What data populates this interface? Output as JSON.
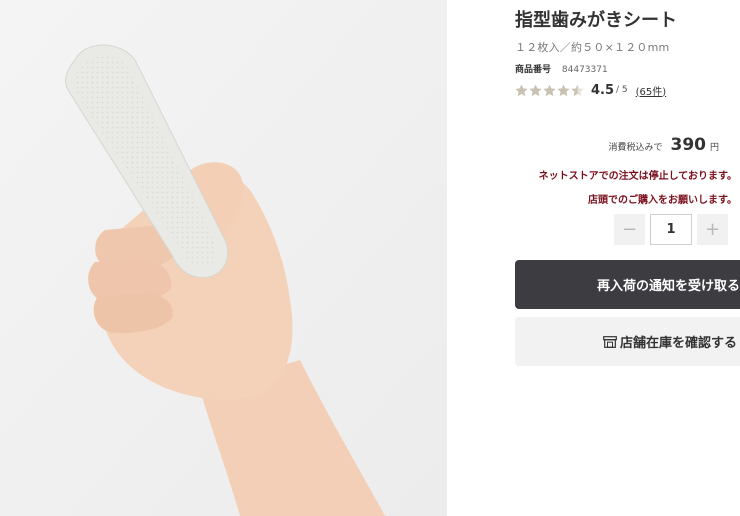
{
  "product": {
    "image_alt": "指型歯みがきシートを指にはめた手",
    "title": "指型歯みがきシート",
    "spec": "１２枚入／約５０×１２０mm",
    "code_label": "商品番号",
    "code_value": "84473371",
    "rating": {
      "score": "4.5",
      "out_of": "/ 5",
      "reviews": "(65件)",
      "stars_value": 4.5,
      "stars_max": 5
    },
    "price": {
      "note": "消費税込みで",
      "value": "390",
      "unit": "円"
    },
    "notices": [
      "ネットストアでの注文は停止しております。",
      "店頭でのご購入をお願いします。"
    ],
    "quantity": {
      "minus_label": "−",
      "value": "1",
      "plus_label": "+"
    },
    "buttons": {
      "restock": "再入荷の通知を受け取る",
      "store_stock": "店舗在庫を確認する"
    }
  },
  "colors": {
    "notice": "#7a0f1c",
    "dark_button": "#3c3c41",
    "light_button": "#f2f2f2",
    "star": "#c9c1b2"
  },
  "icons": {
    "rating": "star-icon",
    "store": "store-icon"
  }
}
